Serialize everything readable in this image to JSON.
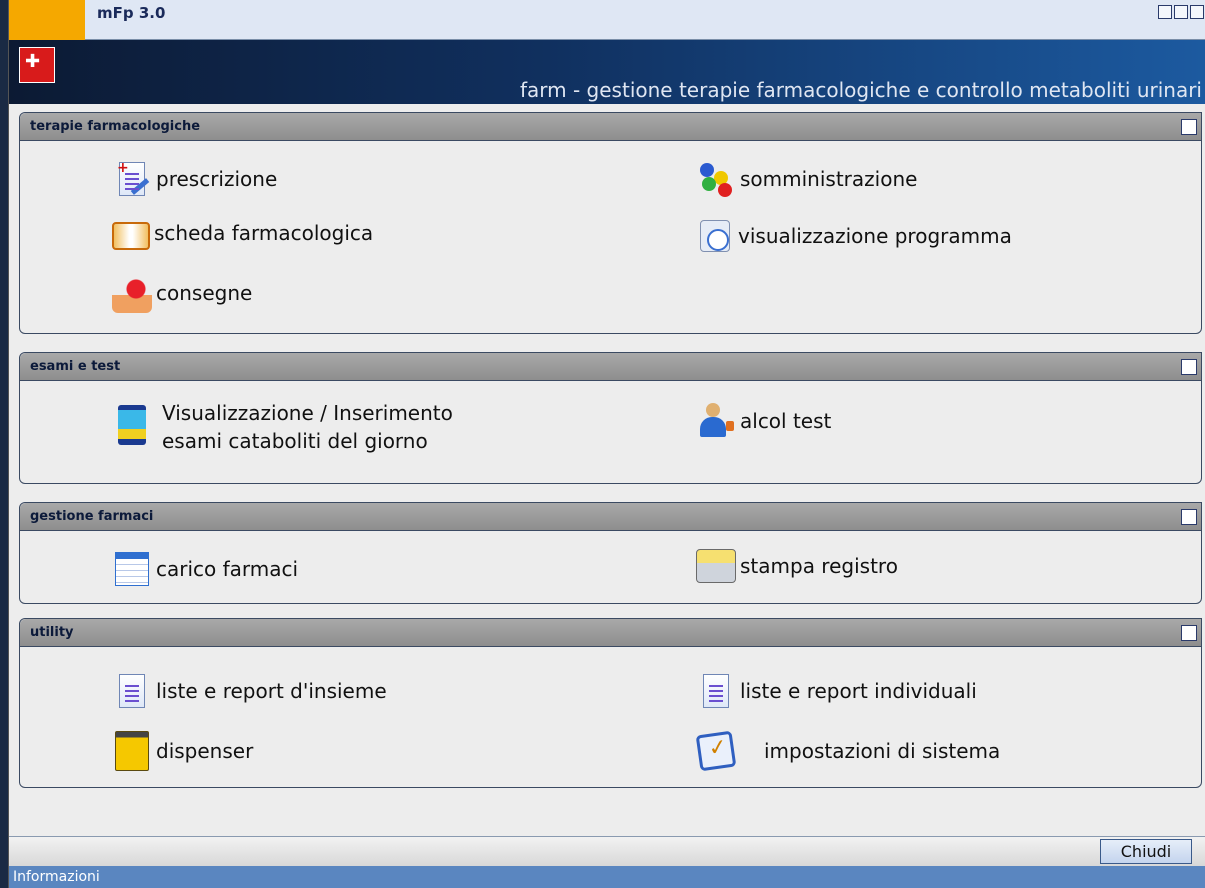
{
  "window": {
    "title": "mFp 3.0",
    "banner_title": "farm - gestione terapie farmacologiche e controllo metaboliti urinari"
  },
  "sections": [
    {
      "title": "terapie farmacologiche",
      "items": [
        {
          "label": "prescrizione",
          "icon": "prescription-icon"
        },
        {
          "label": "somministrazione",
          "icon": "administration-icon"
        },
        {
          "label": "scheda farmacologica",
          "icon": "book-icon"
        },
        {
          "label": "visualizzazione programma",
          "icon": "schedule-clock-icon"
        },
        {
          "label": "consegne",
          "icon": "delivery-hand-icon"
        }
      ]
    },
    {
      "title": "esami e test",
      "items": [
        {
          "label": "Visualizzazione / Inserimento",
          "label2": "esami cataboliti del giorno",
          "icon": "sample-jar-icon"
        },
        {
          "label": "alcol test",
          "icon": "person-test-icon"
        }
      ]
    },
    {
      "title": "gestione farmaci",
      "items": [
        {
          "label": "carico farmaci",
          "icon": "drug-load-icon"
        },
        {
          "label": "stampa registro",
          "icon": "printer-icon"
        }
      ]
    },
    {
      "title": "utility",
      "items": [
        {
          "label": "liste e report d'insieme",
          "icon": "report-document-icon"
        },
        {
          "label": "liste e report individuali",
          "icon": "report-document-icon"
        },
        {
          "label": "dispenser",
          "icon": "dispenser-icon"
        },
        {
          "label": "impostazioni di sistema",
          "icon": "settings-check-icon"
        }
      ]
    }
  ],
  "footer": {
    "close_label": "Chiudi",
    "status_text": "Informazioni"
  },
  "colors": {
    "accent_orange": "#f5a800",
    "banner_dark": "#0c1a33",
    "banner_light": "#1c5aa0",
    "status_blue": "#5a86c0"
  }
}
